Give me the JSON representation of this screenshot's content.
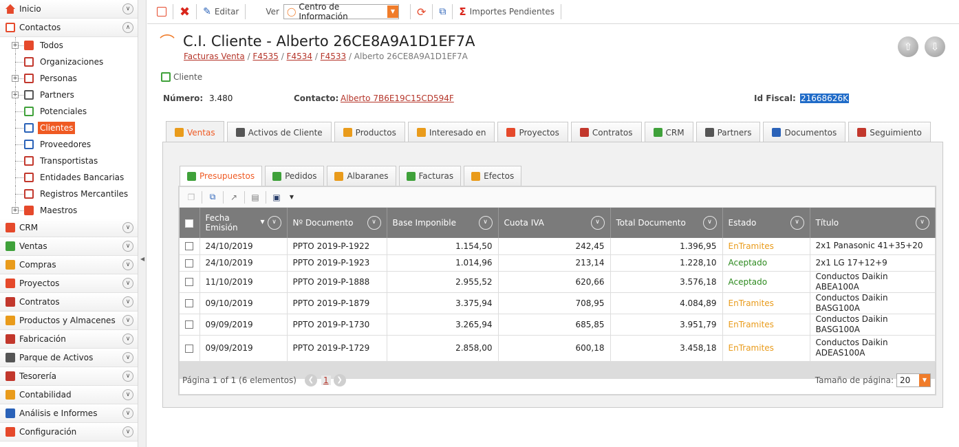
{
  "sidebar": {
    "inicio": "Inicio",
    "contactos": "Contactos",
    "tree": [
      "Todos",
      "Organizaciones",
      "Personas",
      "Partners",
      "Potenciales",
      "Clientes",
      "Proveedores",
      "Transportistas",
      "Entidades Bancarias",
      "Registros Mercantiles",
      "Maestros"
    ],
    "sections": [
      "CRM",
      "Ventas",
      "Compras",
      "Proyectos",
      "Contratos",
      "Productos y Almacenes",
      "Fabricación",
      "Parque de Activos",
      "Tesorería",
      "Contabilidad",
      "Análisis e Informes",
      "Configuración"
    ]
  },
  "toolbar": {
    "editar": "Editar",
    "ver": "Ver",
    "view_value": "Centro de Información",
    "importes": "Importes Pendientes"
  },
  "header": {
    "title": "C.I. Cliente - Alberto 26CE8A9A1D1EF7A",
    "crumbs": [
      "Facturas Venta",
      "F4535",
      "F4534",
      "F4533"
    ],
    "crumb_current": "Alberto 26CE8A9A1D1EF7A",
    "entity": "Cliente"
  },
  "fields": {
    "numero_label": "Número:",
    "numero": "3.480",
    "contacto_label": "Contacto:",
    "contacto": "Alberto 7B6E19C15CD594F",
    "idfiscal_label": "Id Fiscal:",
    "idfiscal": "21668626K"
  },
  "tabs": [
    "Ventas",
    "Activos de Cliente",
    "Productos",
    "Interesado en",
    "Proyectos",
    "Contratos",
    "CRM",
    "Partners",
    "Documentos",
    "Seguimiento"
  ],
  "subtabs": [
    "Presupuestos",
    "Pedidos",
    "Albaranes",
    "Facturas",
    "Efectos"
  ],
  "grid": {
    "columns": [
      "Fecha Emisión",
      "Nº Documento",
      "Base Imponible",
      "Cuota IVA",
      "Total Documento",
      "Estado",
      "Título"
    ],
    "rows": [
      [
        "24/10/2019",
        "PPTO 2019-P-1922",
        "1.154,50",
        "242,45",
        "1.396,95",
        "EnTramites",
        "2x1 Panasonic 41+35+20"
      ],
      [
        "24/10/2019",
        "PPTO 2019-P-1923",
        "1.014,96",
        "213,14",
        "1.228,10",
        "Aceptado",
        "2x1 LG 17+12+9"
      ],
      [
        "11/10/2019",
        "PPTO 2019-P-1888",
        "2.955,52",
        "620,66",
        "3.576,18",
        "Aceptado",
        "Conductos Daikin ABEA100A"
      ],
      [
        "09/10/2019",
        "PPTO 2019-P-1879",
        "3.375,94",
        "708,95",
        "4.084,89",
        "EnTramites",
        "Conductos Daikin BASG100A"
      ],
      [
        "09/09/2019",
        "PPTO 2019-P-1730",
        "3.265,94",
        "685,85",
        "3.951,79",
        "EnTramites",
        "Conductos Daikin BASG100A"
      ],
      [
        "09/09/2019",
        "PPTO 2019-P-1729",
        "2.858,00",
        "600,18",
        "3.458,18",
        "EnTramites",
        "Conductos Daikin ADEAS100A"
      ]
    ],
    "pager_text": "Página 1 of 1 (6 elementos)",
    "page": "1",
    "page_size_label": "Tamaño de página:",
    "page_size": "20"
  },
  "colors": {
    "accent": "#ef5a23",
    "link": "#b5352a",
    "header": "#7b7b7b",
    "entramites": "#e99b1b",
    "aceptado": "#2d8a1f"
  }
}
